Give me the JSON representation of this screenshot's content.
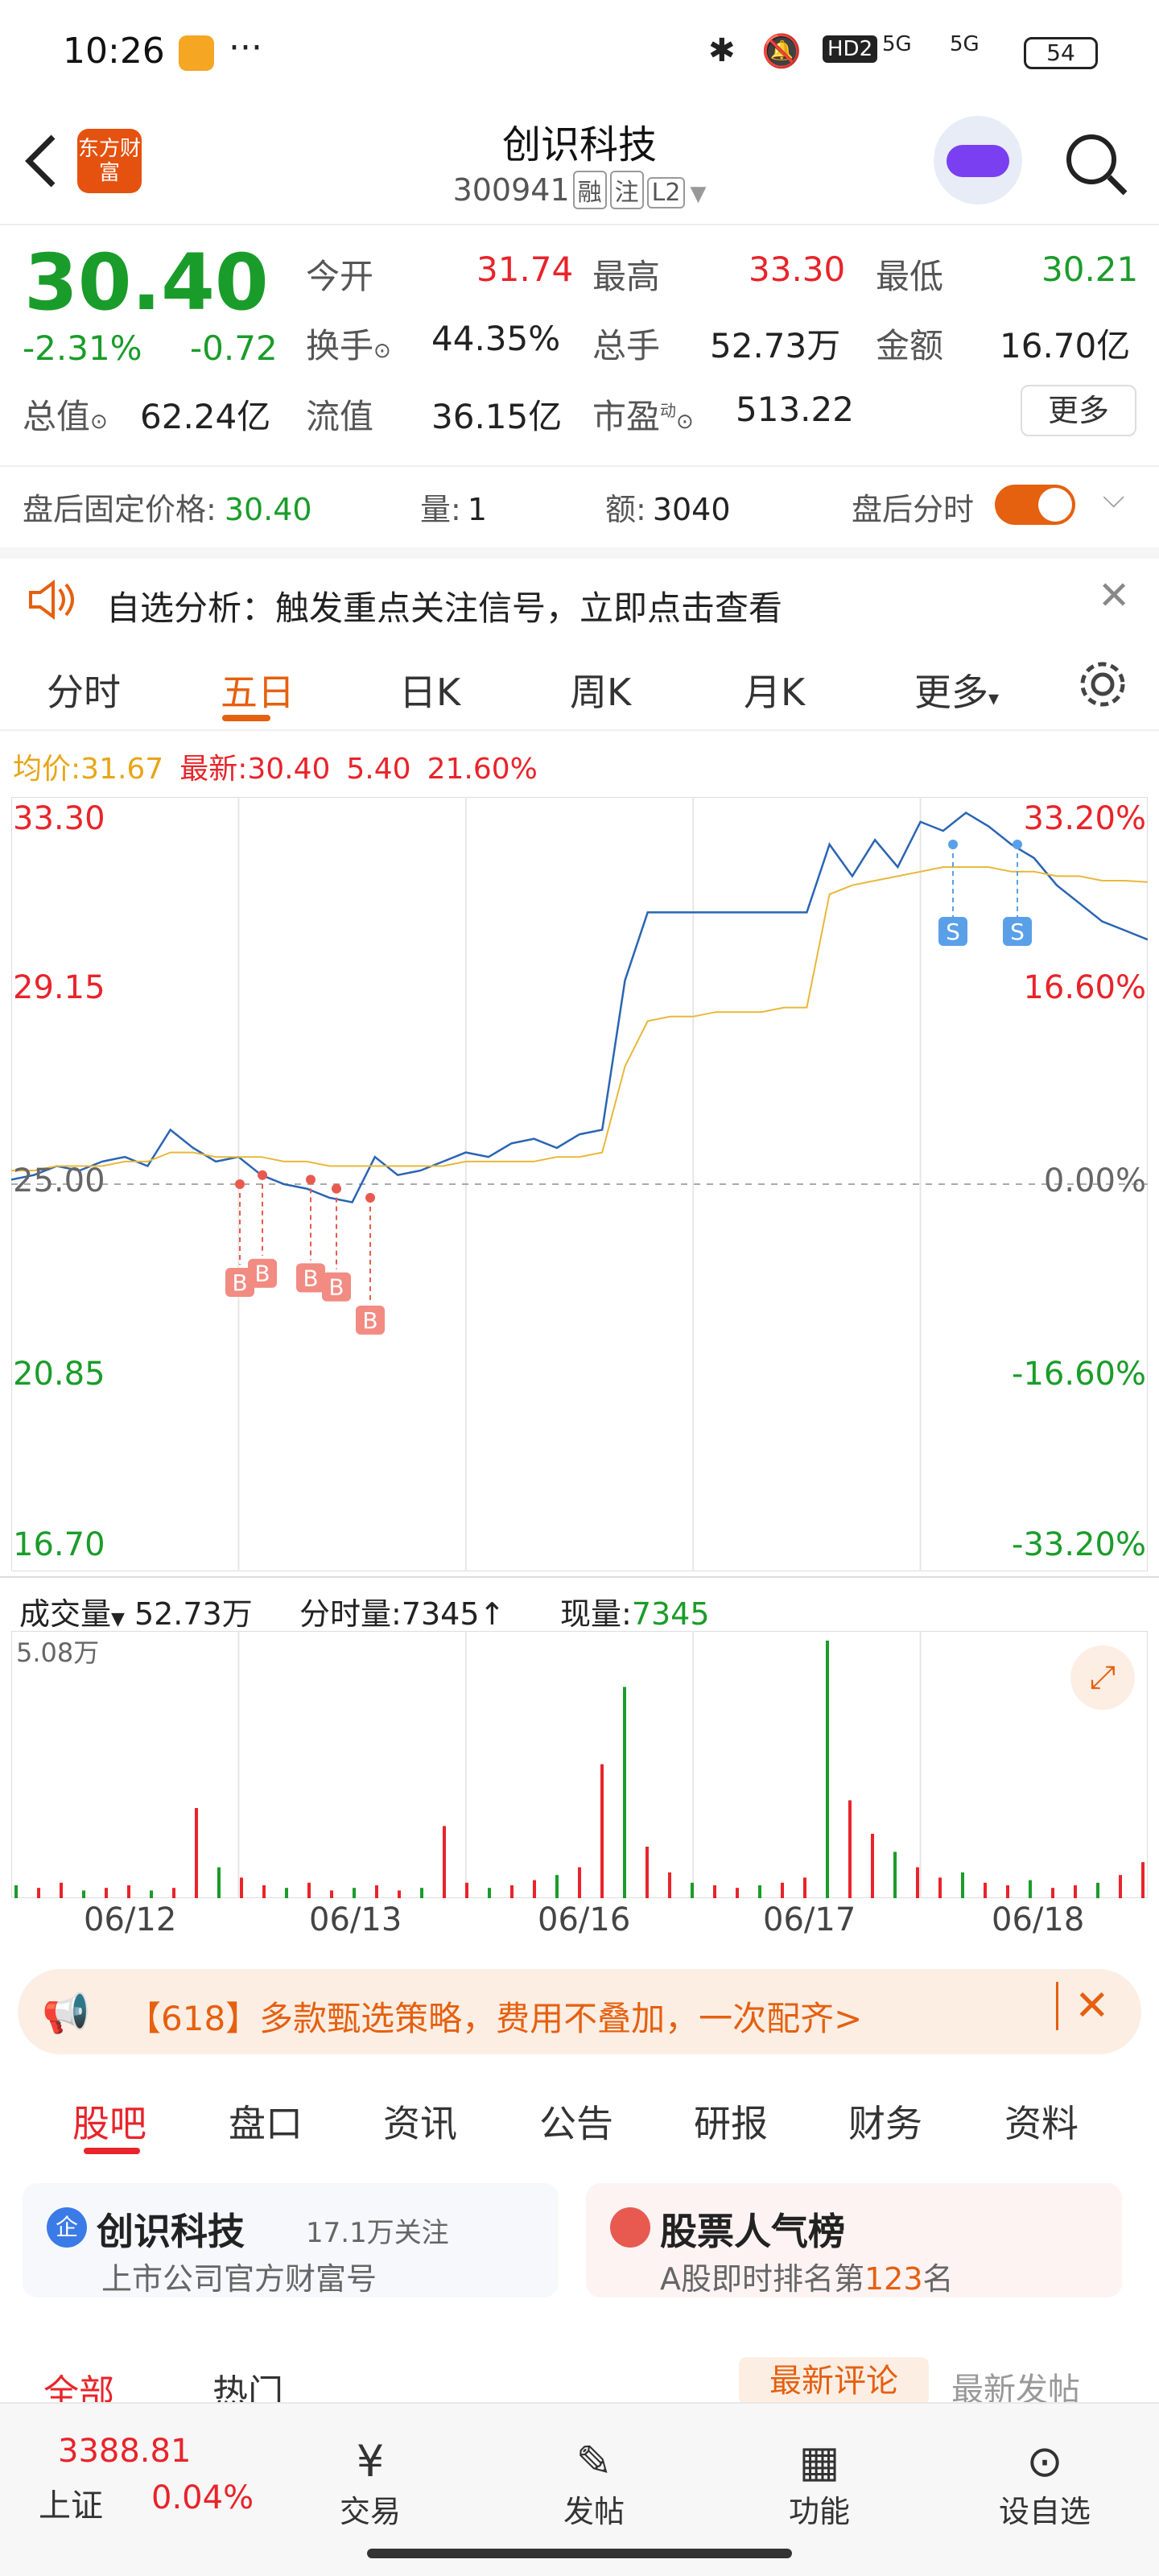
{
  "status": {
    "time": "10:26",
    "dots": "···",
    "battery": "54",
    "net1": "5G",
    "net2": "5G",
    "hd": "HD2"
  },
  "header": {
    "title": "创识科技",
    "code": "300941",
    "tags": [
      "融",
      "注",
      "L2"
    ],
    "app": "东方财富"
  },
  "quote": {
    "price": "30.40",
    "chg_pct": "-2.31%",
    "chg": "-0.72",
    "open_label": "今开",
    "open": "31.74",
    "high_label": "最高",
    "high": "33.30",
    "low_label": "最低",
    "low": "30.21",
    "turnover_label": "换手",
    "turnover": "44.35%",
    "vol_label": "总手",
    "vol": "52.73万",
    "amt_label": "金额",
    "amt": "16.70亿",
    "mcap_label": "总值",
    "mcap": "62.24亿",
    "float_label": "流值",
    "float": "36.15亿",
    "pe_label": "市盈",
    "pe": "513.22",
    "pe_sup": "动",
    "more": "更多"
  },
  "after": {
    "price_label": "盘后固定价格:",
    "price": "30.40",
    "qty_label": "量:",
    "qty": "1",
    "amt_label": "额:",
    "amt": "3040",
    "toggle_label": "盘后分时"
  },
  "notice": {
    "text": "自选分析：触发重点关注信号，立即点击查看"
  },
  "tabs": [
    "分时",
    "五日",
    "日K",
    "周K",
    "月K",
    "更多"
  ],
  "info": {
    "avg_label": "均价:",
    "avg": "31.67",
    "last_label": "最新:",
    "last": "30.40",
    "chg": "5.40",
    "pct": "21.60%"
  },
  "chart_data": {
    "type": "line",
    "title": "",
    "x": [
      "06/12",
      "06/13",
      "06/16",
      "06/17",
      "06/18"
    ],
    "y_left": [
      "33.30",
      "29.15",
      "25.00",
      "20.85",
      "16.70"
    ],
    "y_right": [
      "33.20%",
      "16.60%",
      "0.00%",
      "-16.60%",
      "-33.20%"
    ],
    "ylim": [
      16.7,
      33.3
    ],
    "prev_close": 25.0,
    "series": [
      {
        "name": "",
        "values": [
          25.1,
          25.2,
          25.4,
          25.3,
          25.5,
          25.6,
          25.4,
          26.2,
          25.8,
          25.5,
          25.6,
          25.2,
          25.0,
          24.9,
          24.7,
          24.6,
          25.6,
          25.2,
          25.3,
          25.5,
          25.7,
          25.6,
          25.9,
          26.0,
          25.8,
          26.1,
          26.2,
          29.5,
          31.0,
          31.0,
          31.0,
          31.0,
          31.0,
          31.0,
          31.0,
          31.0,
          32.5,
          31.8,
          32.6,
          32.0,
          33.0,
          32.8,
          33.2,
          32.9,
          32.5,
          32.2,
          31.6,
          31.2,
          30.8,
          30.6,
          30.4
        ]
      },
      {
        "name": "",
        "values": [
          25.3,
          25.3,
          25.4,
          25.4,
          25.4,
          25.5,
          25.5,
          25.7,
          25.7,
          25.6,
          25.6,
          25.6,
          25.5,
          25.5,
          25.4,
          25.4,
          25.4,
          25.4,
          25.4,
          25.4,
          25.5,
          25.5,
          25.5,
          25.5,
          25.6,
          25.6,
          25.7,
          27.6,
          28.6,
          28.7,
          28.7,
          28.8,
          28.8,
          28.8,
          28.9,
          28.9,
          31.4,
          31.6,
          31.7,
          31.8,
          31.9,
          32.0,
          32.0,
          32.0,
          31.9,
          31.9,
          31.8,
          31.8,
          31.7,
          31.7,
          31.67
        ]
      }
    ],
    "buy_markers": [
      "B",
      "B",
      "B",
      "B",
      "B"
    ],
    "sell_markers": [
      "S",
      "S"
    ]
  },
  "volume": {
    "label": "成交量",
    "total": "52.73万",
    "tick_label": "分时量:",
    "tick": "7345↑",
    "now_label": "现量:",
    "now": "7345",
    "max": "5.08万",
    "bars": [
      0.05,
      0.04,
      0.06,
      0.03,
      0.04,
      0.05,
      0.03,
      0.04,
      0.35,
      0.12,
      0.08,
      0.05,
      0.04,
      0.06,
      0.03,
      0.04,
      0.05,
      0.03,
      0.04,
      0.28,
      0.06,
      0.04,
      0.05,
      0.07,
      0.09,
      0.12,
      0.52,
      0.82,
      0.2,
      0.1,
      0.06,
      0.05,
      0.04,
      0.05,
      0.06,
      0.08,
      1.0,
      0.38,
      0.25,
      0.18,
      0.12,
      0.08,
      0.1,
      0.06,
      0.05,
      0.07,
      0.04,
      0.05,
      0.06,
      0.09,
      0.14
    ]
  },
  "banner": {
    "text": "【618】多款甄选策略，费用不叠加，一次配齐>"
  },
  "gtabs": [
    "股吧",
    "盘口",
    "资讯",
    "公告",
    "研报",
    "财务",
    "资料"
  ],
  "cards": {
    "c1_title": "创识科技",
    "c1_follow": "17.1万关注",
    "c1_sub": "上市公司官方财富号",
    "c2_title": "股票人气榜",
    "c2_sub_a": "A股即时排名第",
    "c2_rank": "123",
    "c2_sub_b": "名"
  },
  "subtabs": {
    "all": "全部",
    "hot": "热门",
    "latest_comment": "最新评论",
    "latest_post": "最新发帖"
  },
  "bottom": {
    "index_val": "3388.81",
    "index_name": "上证",
    "index_pct": "0.04%",
    "items": [
      "交易",
      "发帖",
      "功能",
      "设自选"
    ]
  }
}
